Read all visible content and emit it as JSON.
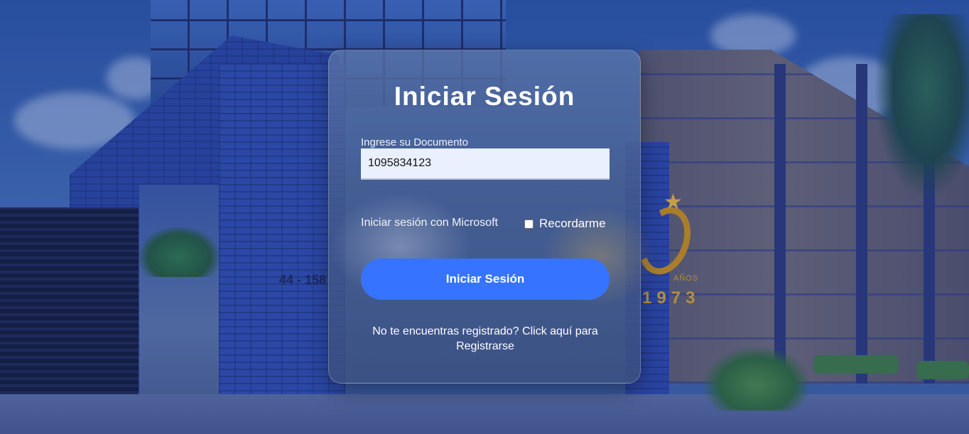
{
  "background": {
    "logo": {
      "anos": "AÑOS",
      "year": "1973"
    },
    "address": "44 - 158"
  },
  "login": {
    "title": "Iniciar Sesión",
    "document_label": "Ingrese su Documento",
    "document_value": "1095834123",
    "microsoft_link": "Iniciar sesión con Microsoft",
    "remember_label": "Recordarme",
    "remember_checked": false,
    "submit_label": "Iniciar Sesión",
    "register_text": "No te encuentras registrado? Click aquí para Registrarse"
  },
  "colors": {
    "button": "#3674ff",
    "input_bg": "#eaf0fd",
    "title": "#ffffff"
  }
}
